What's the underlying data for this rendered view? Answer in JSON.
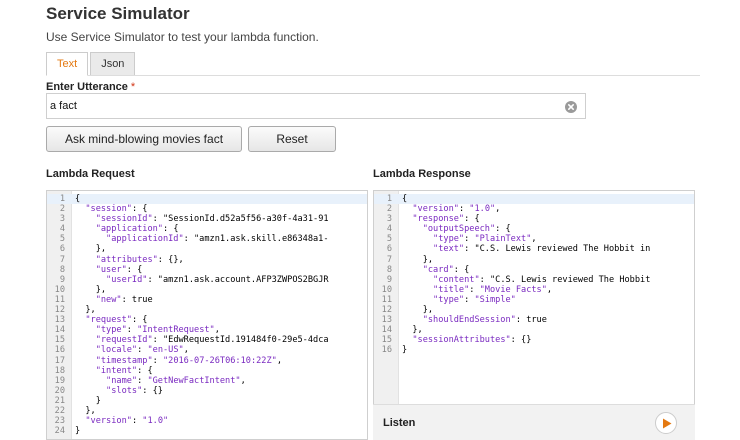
{
  "header": {
    "title": "Service Simulator",
    "subtitle": "Use Service Simulator to test your lambda function."
  },
  "tabs": [
    {
      "label": "Text",
      "active": true
    },
    {
      "label": "Json",
      "active": false
    }
  ],
  "utterance": {
    "label": "Enter Utterance",
    "required_mark": "*",
    "value": "a fact"
  },
  "buttons": {
    "ask_label": "Ask mind-blowing movies fact",
    "reset_label": "Reset"
  },
  "request": {
    "label": "Lambda Request",
    "lines": [
      "{",
      "  \"session\": {",
      "    \"sessionId\": \"SessionId.d52a5f56-a30f-4a31-91",
      "    \"application\": {",
      "      \"applicationId\": \"amzn1.ask.skill.e86348a1-",
      "    },",
      "    \"attributes\": {},",
      "    \"user\": {",
      "      \"userId\": \"amzn1.ask.account.AFP3ZWPOS2BGJR",
      "    },",
      "    \"new\": true",
      "  },",
      "  \"request\": {",
      "    \"type\": \"IntentRequest\",",
      "    \"requestId\": \"EdwRequestId.191484f0-29e5-4dca",
      "    \"locale\": \"en-US\",",
      "    \"timestamp\": \"2016-07-26T06:10:22Z\",",
      "    \"intent\": {",
      "      \"name\": \"GetNewFactIntent\",",
      "      \"slots\": {}",
      "    }",
      "  },",
      "  \"version\": \"1.0\"",
      "}"
    ]
  },
  "response": {
    "label": "Lambda Response",
    "lines": [
      "{",
      "  \"version\": \"1.0\",",
      "  \"response\": {",
      "    \"outputSpeech\": {",
      "      \"type\": \"PlainText\",",
      "      \"text\": \"C.S. Lewis reviewed The Hobbit in",
      "    },",
      "    \"card\": {",
      "      \"content\": \"C.S. Lewis reviewed The Hobbit",
      "      \"title\": \"Movie Facts\",",
      "      \"type\": \"Simple\"",
      "    },",
      "    \"shouldEndSession\": true",
      "  },",
      "  \"sessionAttributes\": {}",
      "}"
    ]
  },
  "listen": {
    "label": "Listen"
  },
  "colors": {
    "accent": "#e47911",
    "json_key": "#7a2ac0",
    "required": "#d13212"
  },
  "icons": {
    "clear": "clear-circle-x-icon",
    "play": "play-triangle-icon"
  }
}
